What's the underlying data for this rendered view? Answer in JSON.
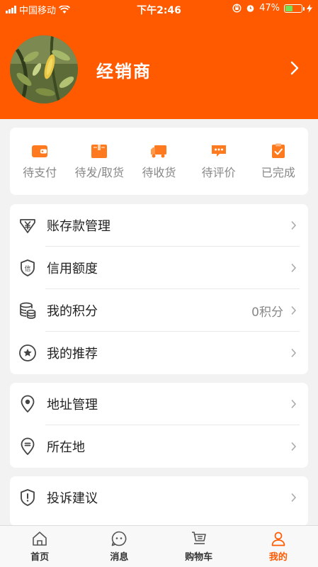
{
  "status_bar": {
    "carrier": "中国移动",
    "time": "下午2:46",
    "battery": "47%",
    "battery_level": 0.47
  },
  "profile": {
    "name": "经销商"
  },
  "orders": [
    {
      "label": "待支付",
      "icon": "wallet-icon"
    },
    {
      "label": "待发/取货",
      "icon": "package-icon"
    },
    {
      "label": "待收货",
      "icon": "truck-icon"
    },
    {
      "label": "待评价",
      "icon": "comment-icon"
    },
    {
      "label": "已完成",
      "icon": "clipboard-check-icon"
    }
  ],
  "menu": {
    "group1": [
      {
        "label": "账存款管理",
        "icon": "yen-shield-icon"
      },
      {
        "label": "信用额度",
        "icon": "credit-shield-icon"
      },
      {
        "label": "我的积分",
        "value": "0积分",
        "icon": "coins-icon"
      },
      {
        "label": "我的推荐",
        "icon": "star-circle-icon"
      }
    ],
    "group2": [
      {
        "label": "地址管理",
        "icon": "location-pin-icon"
      },
      {
        "label": "所在地",
        "icon": "location-marker-icon"
      }
    ],
    "group3": [
      {
        "label": "投诉建议",
        "icon": "alert-shield-icon"
      }
    ]
  },
  "tabbar": [
    {
      "label": "首页",
      "icon": "home-icon",
      "active": false
    },
    {
      "label": "消息",
      "icon": "message-icon",
      "active": false
    },
    {
      "label": "购物车",
      "icon": "cart-icon",
      "active": false
    },
    {
      "label": "我的",
      "icon": "user-icon",
      "active": true
    }
  ],
  "colors": {
    "brand": "#ff5a00",
    "icon_gray": "#444444"
  }
}
